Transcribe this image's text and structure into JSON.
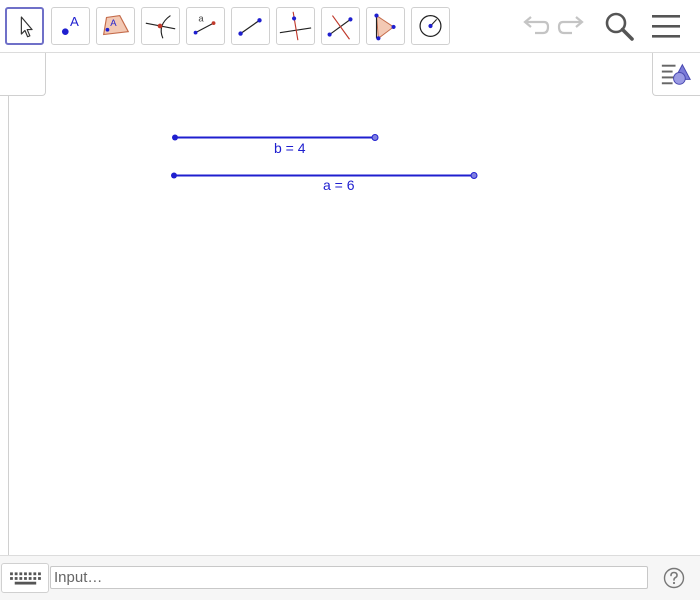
{
  "toolbar": {
    "tools": [
      {
        "id": "move",
        "icon": "move-arrow-icon",
        "active": true
      },
      {
        "id": "point",
        "icon": "point-icon",
        "label": "A"
      },
      {
        "id": "polygon",
        "icon": "polygon-icon",
        "label": "A"
      },
      {
        "id": "intersect",
        "icon": "intersect-icon"
      },
      {
        "id": "midpoint",
        "icon": "midpoint-icon",
        "label": "a"
      },
      {
        "id": "segment",
        "icon": "segment-icon"
      },
      {
        "id": "perpendicular",
        "icon": "perpendicular-line-icon"
      },
      {
        "id": "perpendicular-bisector",
        "icon": "perpendicular-bisector-icon"
      },
      {
        "id": "angle-bisector",
        "icon": "angle-bisector-icon"
      },
      {
        "id": "circle",
        "icon": "circle-center-point-icon"
      }
    ],
    "undo_icon": "undo-icon",
    "redo_icon": "redo-icon",
    "search_icon": "search-icon",
    "menu_icon": "menu-icon"
  },
  "graphics": {
    "segments": [
      {
        "name": "b",
        "label": "b = 4",
        "color": "#1f1fcf"
      },
      {
        "name": "a",
        "label": "a = 6",
        "color": "#1f1fcf"
      }
    ]
  },
  "stylebar": {
    "icon": "style-bar-icon"
  },
  "inputbar": {
    "keyboard_icon": "keyboard-icon",
    "placeholder": "Input…",
    "value": "",
    "help_icon": "help-icon"
  },
  "colors": {
    "accent": "#6f70c8",
    "object": "#1f1fcf",
    "border": "#d0d0d0"
  }
}
